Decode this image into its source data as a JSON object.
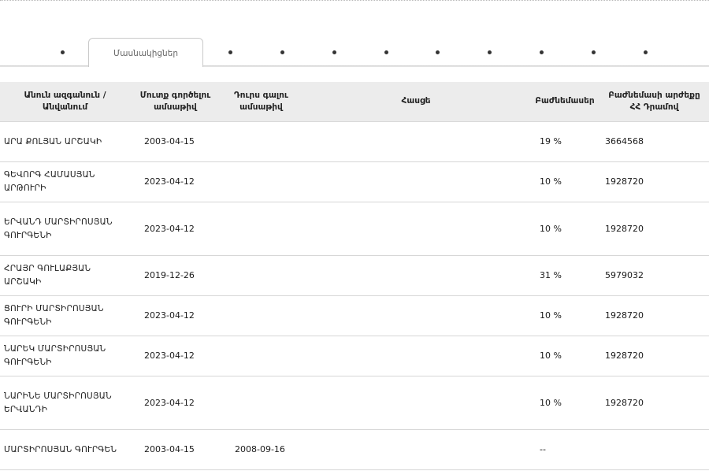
{
  "tabs": {
    "active_label": "Մասնակիցներ"
  },
  "table": {
    "headers": {
      "name": "Անուն ազգանուն / Անվանում",
      "entry_date": "Մուտք գործելու ամսաթիվ",
      "exit_date": "Դուրս գալու ամսաթիվ",
      "address": "Հասցե",
      "share": "Բաժնեմասեր",
      "share_value": "Բաժնեմասի արժեքը ՀՀ Դրամով"
    },
    "rows": [
      {
        "name": "ԱՐԱ ՔՈԼՅԱՆ ԱՐՇԱԿԻ",
        "entry_date": "2003-04-15",
        "exit_date": "",
        "address": "",
        "share": "19 %",
        "share_value": "3664568"
      },
      {
        "name": "ԳԵՎՈՐԳ ՀԱՄԱՍՅԱՆ ԱՐԹՈՒՐԻ",
        "entry_date": "2023-04-12",
        "exit_date": "",
        "address": "",
        "share": "10 %",
        "share_value": "1928720"
      },
      {
        "name": "ԵՐՎԱՆԴ ՄԱՐՏԻՐՈՍՅԱՆ ԳՈՒՐԳԵՆԻ",
        "entry_date": "2023-04-12",
        "exit_date": "",
        "address": "",
        "share": "10 %",
        "share_value": "1928720"
      },
      {
        "name": "ՀՐԱՅՐ ԳՈՒԼԱՔՅԱՆ ԱՐՇԱԿԻ",
        "entry_date": "2019-12-26",
        "exit_date": "",
        "address": "",
        "share": "31 %",
        "share_value": "5979032"
      },
      {
        "name": "ՑՈՒՐԻ ՄԱՐՏԻՐՈՍՅԱՆ ԳՈՒՐԳԵՆԻ",
        "entry_date": "2023-04-12",
        "exit_date": "",
        "address": "",
        "share": "10 %",
        "share_value": "1928720"
      },
      {
        "name": "ՆԱՐԵԿ ՄԱՐՏԻՐՈՍՅԱՆ ԳՈՒՐԳԵՆԻ",
        "entry_date": "2023-04-12",
        "exit_date": "",
        "address": "",
        "share": "10 %",
        "share_value": "1928720"
      },
      {
        "name": "ՆԱՐԻՆԵ ՄԱՐՏԻՐՈՍՅԱՆ ԵՐՎԱՆԴԻ",
        "entry_date": "2023-04-12",
        "exit_date": "",
        "address": "",
        "share": "10 %",
        "share_value": "1928720"
      },
      {
        "name": "ՄԱՐՏԻՐՈՍՅԱՆ ԳՈՒՐԳԵՆ",
        "entry_date": "2003-04-15",
        "exit_date": "2008-09-16",
        "address": "",
        "share": "--",
        "share_value": ""
      }
    ]
  }
}
